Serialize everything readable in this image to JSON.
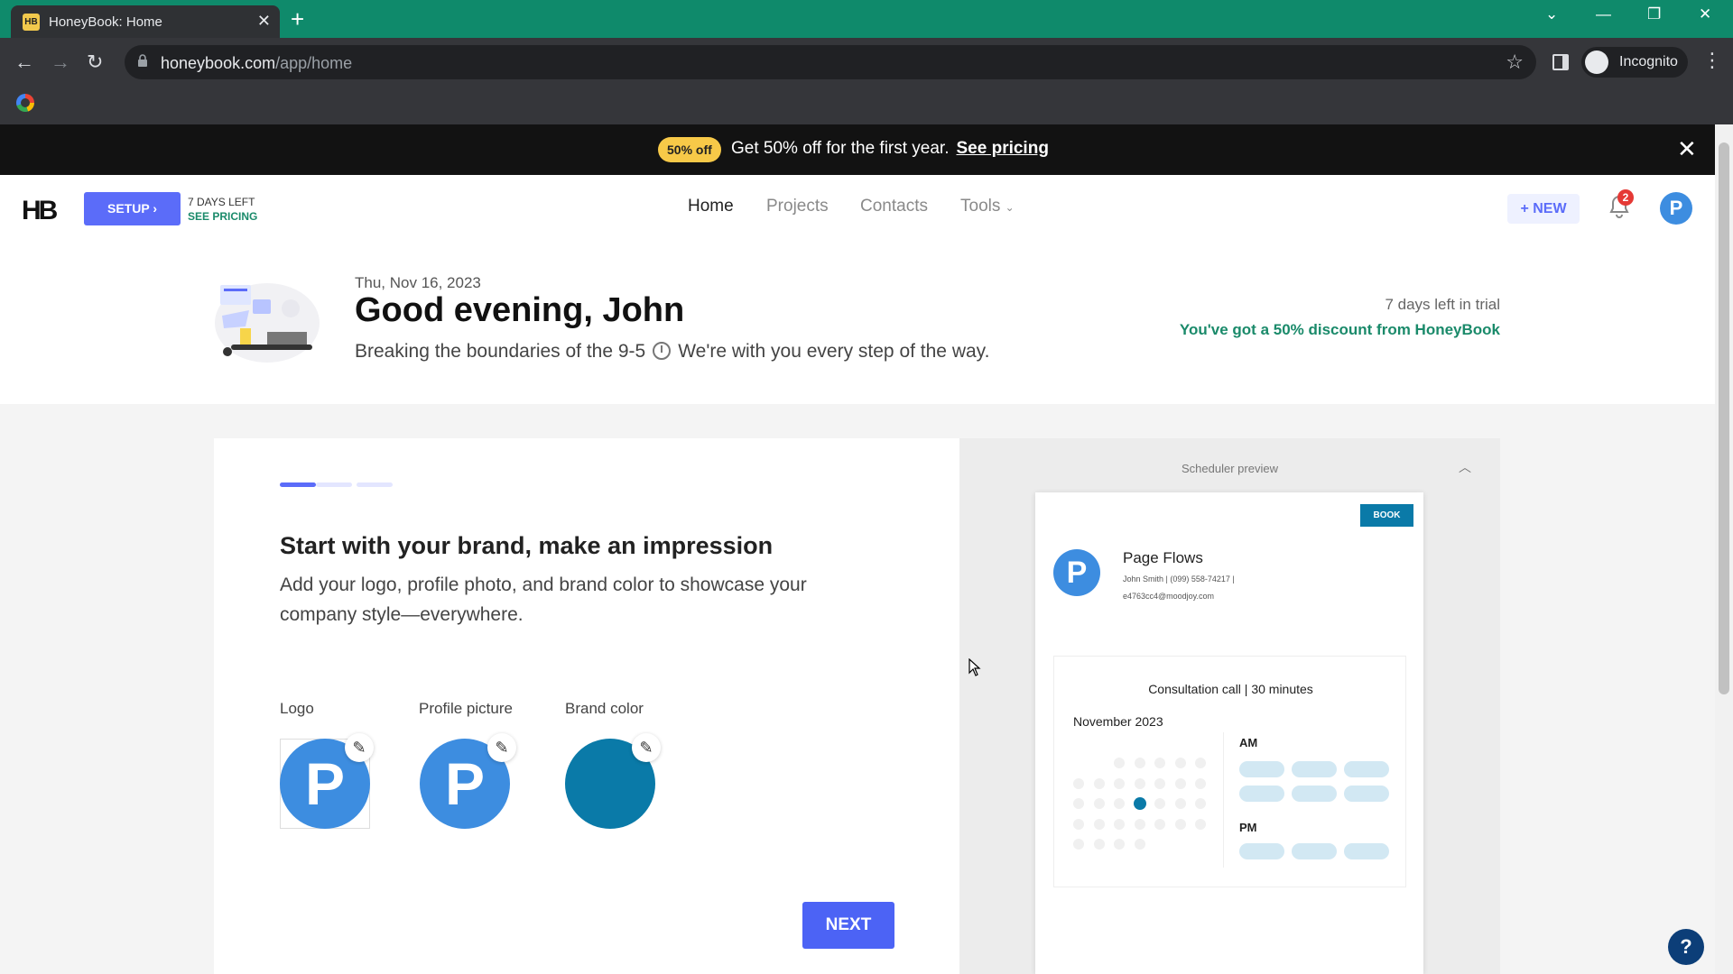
{
  "browser": {
    "tab_title": "HoneyBook: Home",
    "tab_favicon": "HB",
    "url_host": "honeybook.com",
    "url_path": "/app/home",
    "profile_label": "Incognito"
  },
  "promo": {
    "badge": "50% off",
    "message": "Get 50% off for the first year.",
    "link": "See pricing"
  },
  "header": {
    "logo": "HB",
    "setup_label": "SETUP",
    "days_left": "7 DAYS LEFT",
    "see_pricing": "SEE PRICING",
    "nav": [
      "Home",
      "Projects",
      "Contacts",
      "Tools"
    ],
    "new_label": "NEW",
    "notification_count": "2",
    "avatar_letter": "P"
  },
  "greeting": {
    "date": "Thu, Nov 16, 2023",
    "title": "Good evening, John",
    "subtitle_a": "Breaking the boundaries of the 9-5",
    "subtitle_b": "We're with you every step of the way.",
    "trial_days": "7 days left in trial",
    "trial_discount": "You've got a 50% discount from HoneyBook"
  },
  "brand_card": {
    "title": "Start with your brand, make an impression",
    "description": "Add your logo, profile photo, and brand color to showcase your company style—everywhere.",
    "assets": [
      {
        "label": "Logo",
        "letter": "P",
        "color": "#3d8de0"
      },
      {
        "label": "Profile picture",
        "letter": "P",
        "color": "#3d8de0"
      },
      {
        "label": "Brand color",
        "letter": "",
        "color": "#0a7aa8"
      }
    ],
    "progress_steps": 3,
    "progress_current": 1,
    "next_label": "NEXT"
  },
  "scheduler": {
    "label": "Scheduler preview",
    "book_label": "BOOK",
    "avatar_letter": "P",
    "company_name": "Page Flows",
    "contact_line1": "John Smith | (099) 558-74217 |",
    "contact_line2": "e4763cc4@moodjoy.com",
    "consult_title": "Consultation call | 30 minutes",
    "month": "November 2023",
    "am_label": "AM",
    "pm_label": "PM"
  },
  "colors": {
    "accent": "#5b6cf9",
    "brand_teal": "#0a7aa8",
    "discount_green": "#1a8a6a",
    "tab_bar": "#0f8a6b"
  },
  "help_label": "?"
}
